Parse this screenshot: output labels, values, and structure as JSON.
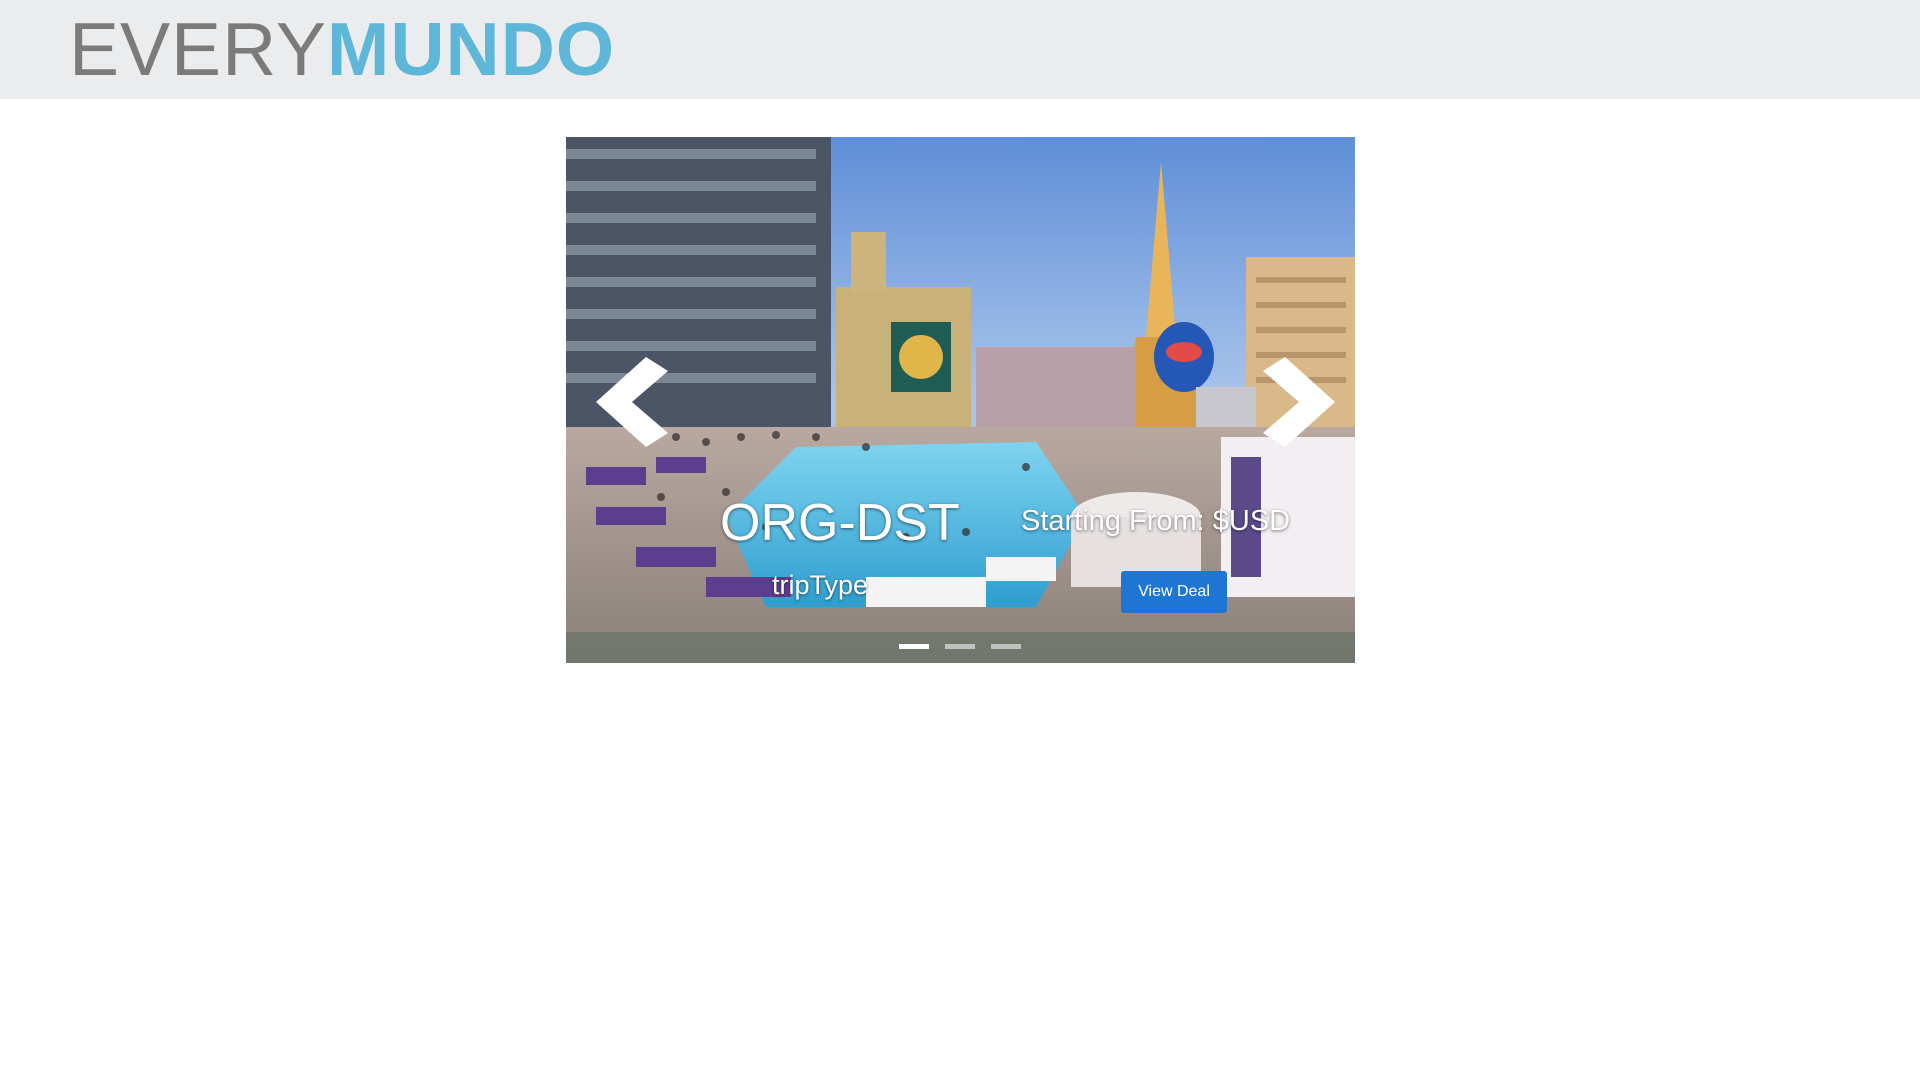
{
  "header": {
    "logo_part1": "EVERY",
    "logo_part2": "MUNDO",
    "background": "#ebecee",
    "logo_gray": "#7b7b7b",
    "logo_blue": "#5fb7d8"
  },
  "carousel": {
    "route": "ORG-DST",
    "price": "Starting From: $USD",
    "trip_type": "tripType",
    "cta_label": "View Deal",
    "cta_color": "#1f76d2",
    "prev_icon": "chevron-left-icon",
    "next_icon": "chevron-right-icon",
    "slide_count": 3,
    "active_slide": 1
  }
}
